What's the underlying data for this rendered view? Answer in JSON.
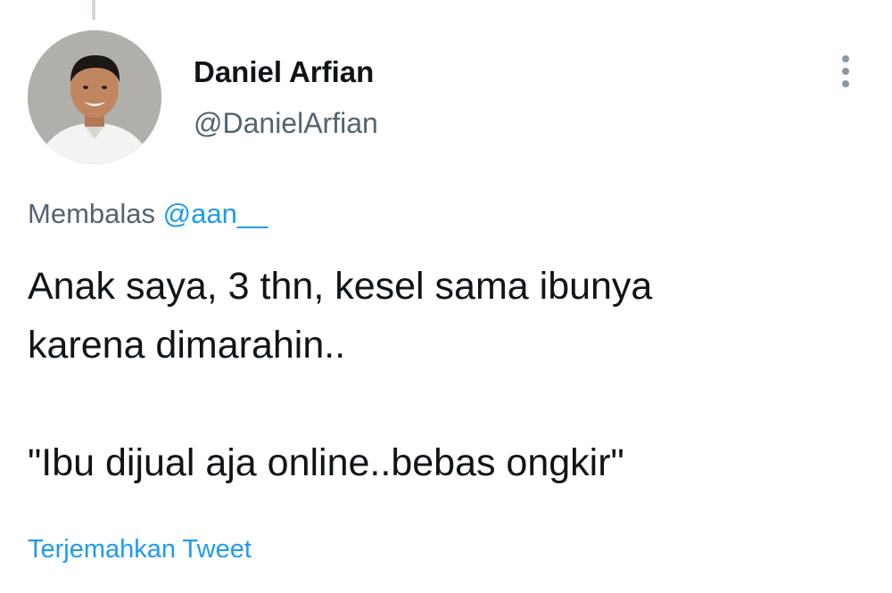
{
  "tweet": {
    "author": {
      "display_name": "Daniel Arfian",
      "handle": "@DanielArfian"
    },
    "reply_prefix": "Membalas",
    "reply_to": "@aan__",
    "text_lines": [
      "Anak saya, 3 thn, kesel sama ibunya",
      "karena dimarahin..",
      "\"Ibu dijual aja online..bebas ongkir\""
    ],
    "translate_label": "Terjemahkan Tweet"
  },
  "icons": {
    "more": "more-vertical-icon"
  },
  "colors": {
    "text": "#0f1419",
    "secondary": "#536471",
    "link": "#1d9bf0",
    "thread_line": "#cfd9de"
  }
}
